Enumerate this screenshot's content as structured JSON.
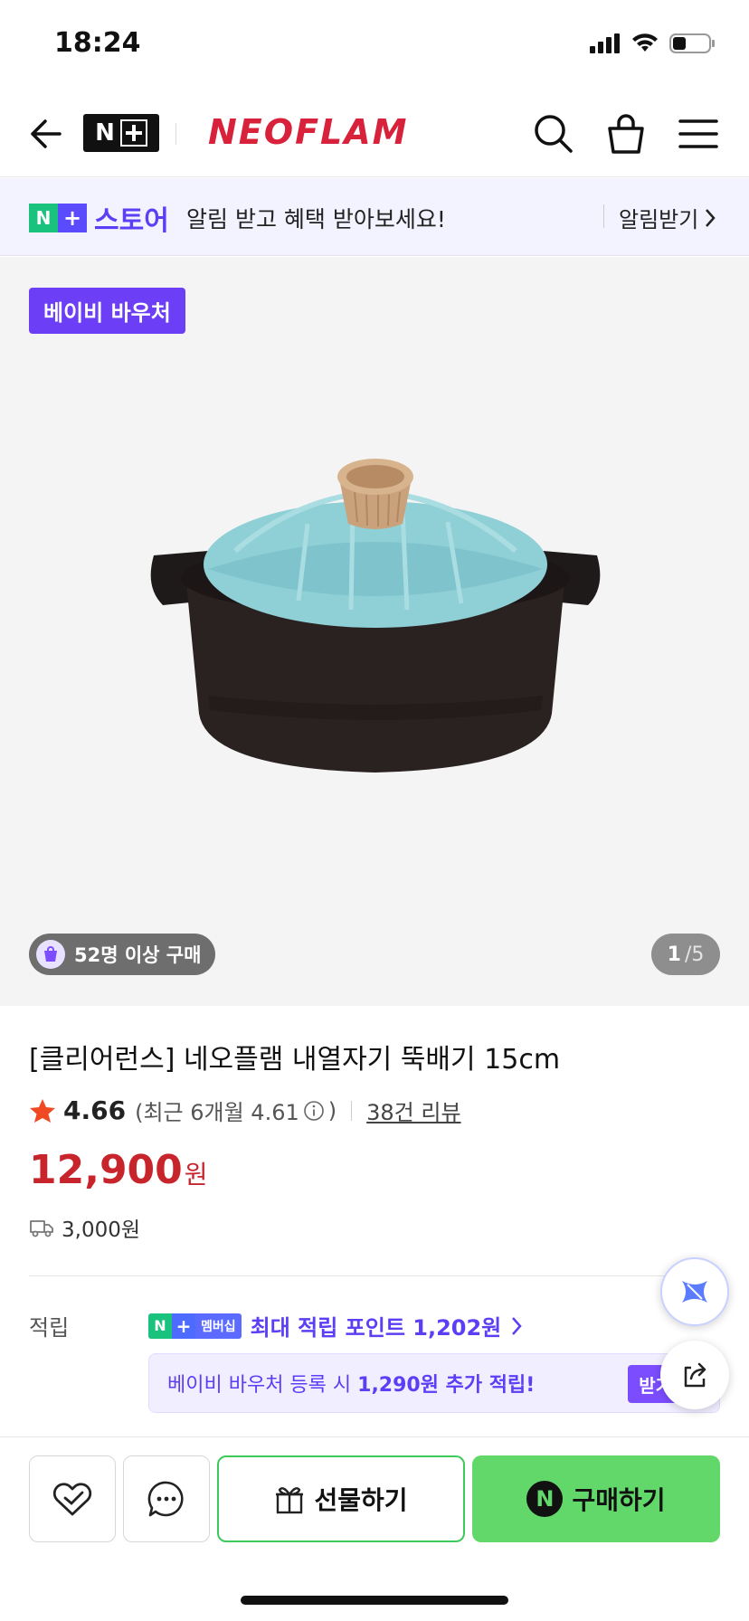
{
  "status": {
    "time": "18:24"
  },
  "header": {
    "brand": "NEOFLAM"
  },
  "promo": {
    "badge_n": "N",
    "badge_plus": "+",
    "store": "스토어",
    "message": "알림 받고 혜택 받아보세요!",
    "action": "알림받기"
  },
  "product": {
    "badge": "베이비 바우처",
    "buyers": "52명 이상 구매",
    "page_current": "1",
    "page_total": "/5",
    "title": "[클리어런스] 네오플램 내열자기 뚝배기 15cm",
    "rating": "4.66",
    "recent_prefix": "(최근 6개월 4.61",
    "recent_suffix": ")",
    "review_link": "38건 리뷰",
    "price": "12,900",
    "price_unit": "원",
    "shipping": "3,000원"
  },
  "points": {
    "label": "적립",
    "member_badge": "멤버십",
    "max_points": "최대 적립 포인트 1,202원",
    "voucher_prefix": "베이비 바우처 등록 시 ",
    "voucher_amount": "1,290원 추가 적립!",
    "voucher_button": "받기"
  },
  "bottom_bar": {
    "gift_label": "선물하기",
    "buy_label": "구매하기",
    "buy_icon": "N"
  },
  "colors": {
    "brand_red": "#d8213a",
    "price_red": "#c8242c",
    "accent_purple": "#5b3ff5",
    "buy_green": "#62d86a",
    "naver_green": "#19c37d"
  }
}
